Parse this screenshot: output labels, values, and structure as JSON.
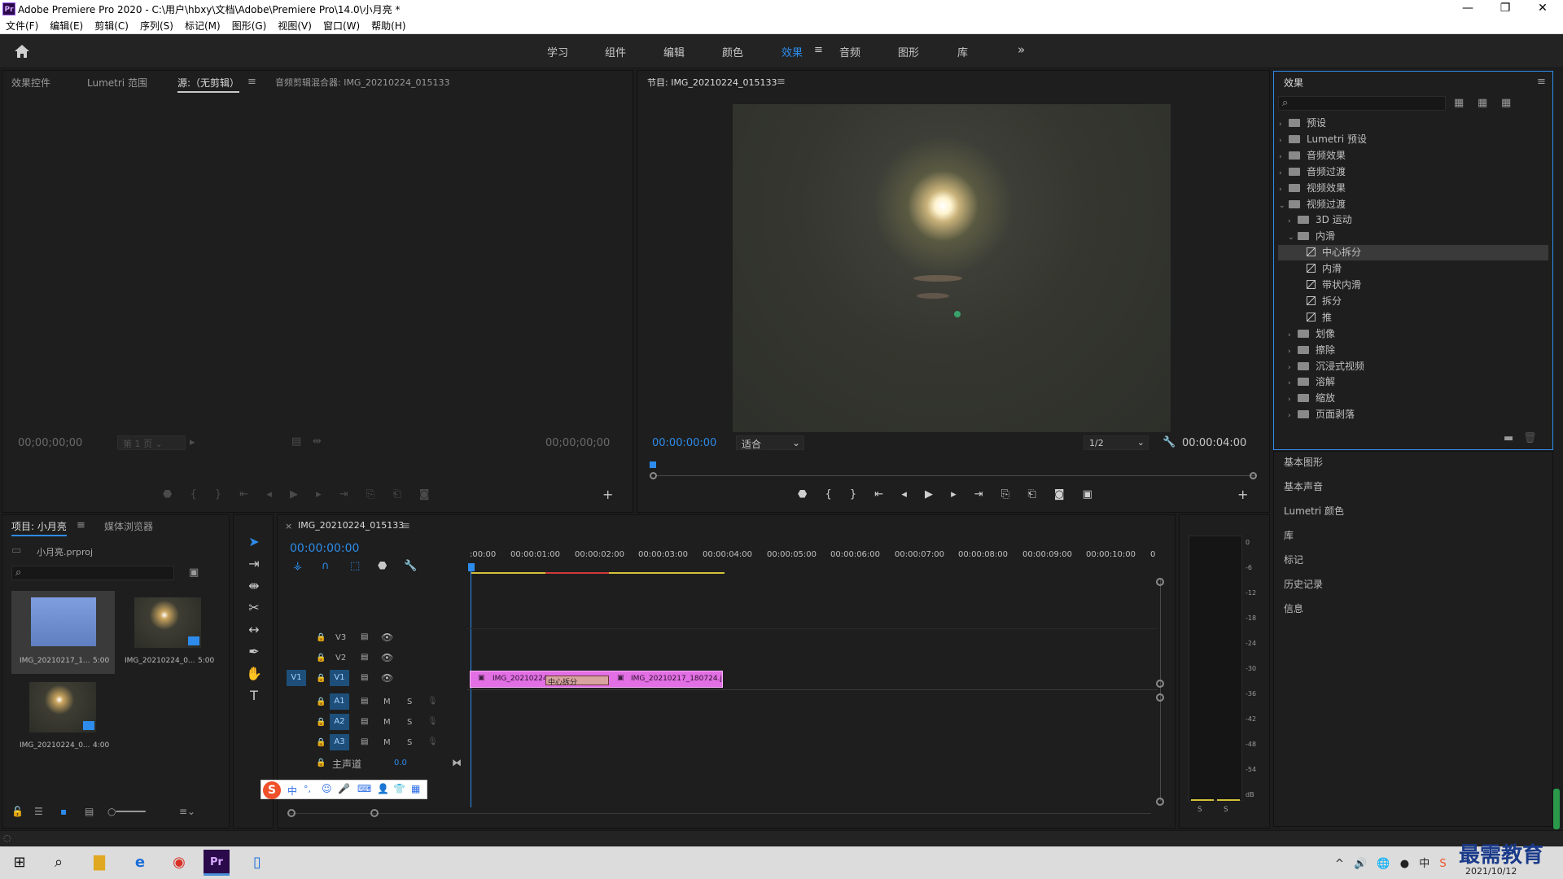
{
  "window": {
    "title": "Adobe Premiere Pro 2020 - C:\\用户\\hbxy\\文档\\Adobe\\Premiere Pro\\14.0\\小月亮 *",
    "app_badge": "Pr",
    "minimize": "—",
    "maximize": "❐",
    "close": "✕"
  },
  "menu": [
    "文件(F)",
    "编辑(E)",
    "剪辑(C)",
    "序列(S)",
    "标记(M)",
    "图形(G)",
    "视图(V)",
    "窗口(W)",
    "帮助(H)"
  ],
  "workspaces": {
    "tabs": [
      "学习",
      "组件",
      "编辑",
      "颜色",
      "效果",
      "音频",
      "图形",
      "库"
    ],
    "active": "效果",
    "more": "»"
  },
  "source_panel": {
    "tabs": [
      "效果控件",
      "Lumetri 范围",
      "源:（无剪辑）",
      "音频剪辑混合器: IMG_20210224_015133"
    ],
    "active_index": 2,
    "timecode_left": "00;00;00;00",
    "page_select": "第 1 页",
    "timecode_right": "00;00;00;00"
  },
  "program_panel": {
    "title": "节目: IMG_20210224_015133",
    "timecode": "00:00:00:00",
    "fit": "适合",
    "resolution": "1/2",
    "duration": "00:00:04:00"
  },
  "effects_panel": {
    "title": "效果",
    "tree": [
      {
        "label": "预设",
        "level": 0,
        "type": "folder",
        "open": false
      },
      {
        "label": "Lumetri 预设",
        "level": 0,
        "type": "folder",
        "open": false
      },
      {
        "label": "音频效果",
        "level": 0,
        "type": "folder",
        "open": false
      },
      {
        "label": "音频过渡",
        "level": 0,
        "type": "folder",
        "open": false
      },
      {
        "label": "视频效果",
        "level": 0,
        "type": "folder",
        "open": false
      },
      {
        "label": "视频过渡",
        "level": 0,
        "type": "folder",
        "open": true
      },
      {
        "label": "3D 运动",
        "level": 1,
        "type": "folder",
        "open": false
      },
      {
        "label": "内滑",
        "level": 1,
        "type": "folder",
        "open": true
      },
      {
        "label": "中心拆分",
        "level": 2,
        "type": "fx",
        "selected": true
      },
      {
        "label": "内滑",
        "level": 2,
        "type": "fx"
      },
      {
        "label": "带状内滑",
        "level": 2,
        "type": "fx"
      },
      {
        "label": "拆分",
        "level": 2,
        "type": "fx"
      },
      {
        "label": "推",
        "level": 2,
        "type": "fx"
      },
      {
        "label": "划像",
        "level": 1,
        "type": "folder",
        "open": false
      },
      {
        "label": "擦除",
        "level": 1,
        "type": "folder",
        "open": false
      },
      {
        "label": "沉浸式视频",
        "level": 1,
        "type": "folder",
        "open": false
      },
      {
        "label": "溶解",
        "level": 1,
        "type": "folder",
        "open": false
      },
      {
        "label": "缩放",
        "level": 1,
        "type": "folder",
        "open": false
      },
      {
        "label": "页面剥落",
        "level": 1,
        "type": "folder",
        "open": false
      }
    ]
  },
  "side_sections": [
    "基本图形",
    "基本声音",
    "Lumetri 颜色",
    "库",
    "标记",
    "历史记录",
    "信息"
  ],
  "project_panel": {
    "tabs": [
      "项目: 小月亮",
      "媒体浏览器"
    ],
    "file": "小月亮.prproj",
    "items": [
      {
        "name": "IMG_20210217_1...",
        "duration": "5:00"
      },
      {
        "name": "IMG_20210224_0...",
        "duration": "5:00"
      },
      {
        "name": "IMG_20210224_0...",
        "duration": "4:00"
      }
    ]
  },
  "timeline": {
    "tab": "IMG_20210224_015133",
    "timecode": "00:00:00:00",
    "ruler": [
      ":00:00",
      "00:00:01:00",
      "00:00:02:00",
      "00:00:03:00",
      "00:00:04:00",
      "00:00:05:00",
      "00:00:06:00",
      "00:00:07:00",
      "00:00:08:00",
      "00:00:09:00",
      "00:00:10:00",
      "0"
    ],
    "video_tracks": [
      "V3",
      "V2",
      "V1"
    ],
    "audio_tracks": [
      "A1",
      "A2",
      "A3"
    ],
    "source_patch": "V1",
    "master": {
      "label": "主声道",
      "value": "0.0"
    },
    "clips": {
      "clip1": "IMG_20210224",
      "transition": "中心拆分",
      "clip2": "IMG_20210217_180724.j"
    },
    "audio_buttons": {
      "mute": "M",
      "solo": "S"
    }
  },
  "meter": {
    "scale": [
      "0",
      "-6",
      "-12",
      "-18",
      "-24",
      "-30",
      "-36",
      "-42",
      "-48",
      "-54",
      "dB"
    ],
    "solo_left": "S",
    "solo_right": "S"
  },
  "ime": {
    "logo": "S",
    "items": [
      "中",
      "°,",
      "☺",
      "🎤",
      "⌨",
      "👤",
      "👕",
      "▦"
    ]
  },
  "taskbar": {
    "date": "2021/10/12",
    "watermark": "最需教育"
  }
}
